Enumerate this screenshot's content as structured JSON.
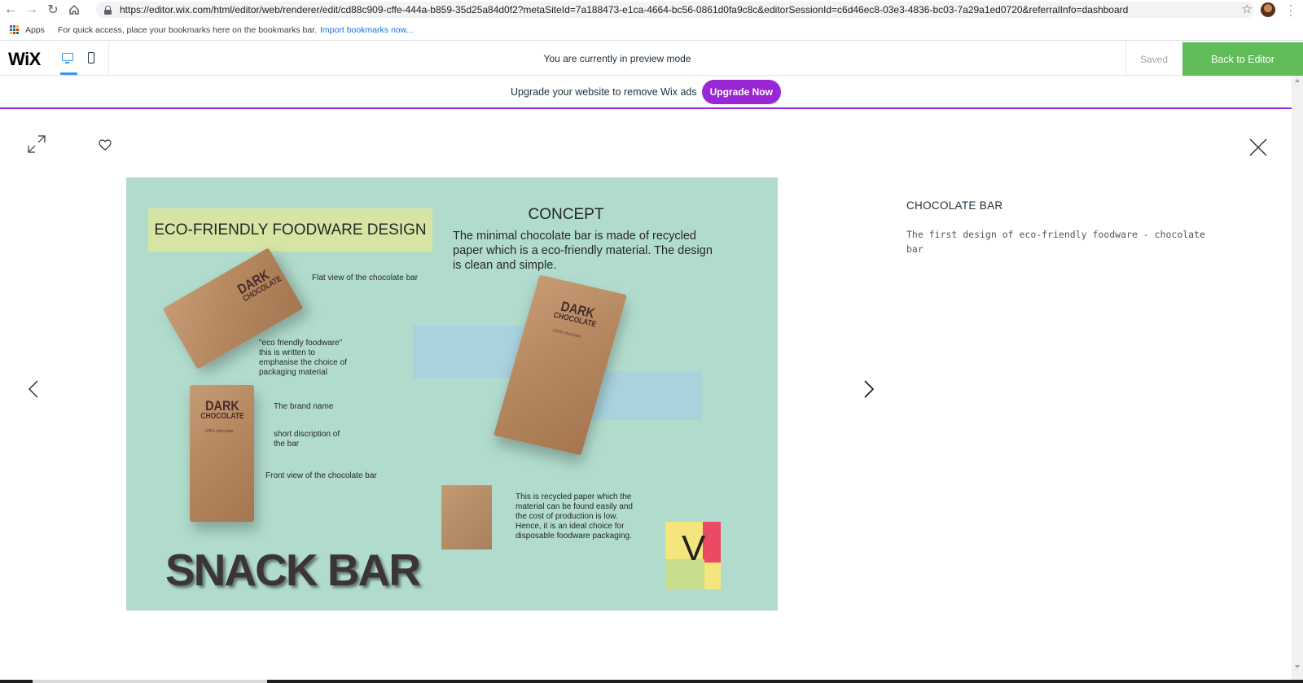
{
  "browser": {
    "url": "https://editor.wix.com/html/editor/web/renderer/edit/cd88c909-cffe-444a-b859-35d25a84d0f2?metaSiteId=7a188473-e1ca-4664-bc56-0861d0fa9c8c&editorSessionId=c6d46ec8-03e3-4836-bc03-7a29a1ed0720&referralInfo=dashboard",
    "apps_label": "Apps",
    "bookmarks_hint": "For quick access, place your bookmarks here on the bookmarks bar.",
    "bookmarks_link": "Import bookmarks now..."
  },
  "wix_bar": {
    "logo": "WiX",
    "preview_message": "You are currently in preview mode",
    "saved_label": "Saved",
    "back_label": "Back to Editor"
  },
  "upgrade": {
    "message": "Upgrade your website to remove Wix ads",
    "button_label": "Upgrade Now",
    "accent_color": "#9a27d5"
  },
  "colors": {
    "editor_blue": "#3899ec",
    "back_green": "#60bc57"
  },
  "icons": [
    "expand-icon",
    "heart-icon",
    "close-icon",
    "chevron-left-icon",
    "chevron-right-icon"
  ],
  "poster": {
    "headline": "ECO-FRIENDLY FOODWARE DESIGN",
    "concept_title": "CONCEPT",
    "concept_body": "The minimal chocolate bar is made of recycled paper which is a eco-friendly material. The design is clean and simple.",
    "label_flat_view": "Flat view of the chocolate bar",
    "label_eco": "\"eco friendly foodware\" this is written to emphasise the choice of packaging material",
    "label_brand": "The brand name",
    "label_short_desc": "short discription of the bar",
    "label_front_view": "Front view of the chocolate bar",
    "label_recycled": "This is recycled paper which the material can be found easily and the cost of production is low. Hence, it is an ideal choice for disposable foodware packaging.",
    "snack_title": "SNACK BAR",
    "pack_brand_line1": "DARK",
    "pack_brand_line2": "CHOCOLATE",
    "pack_percent": "100% chocolate",
    "logo_letter": "V"
  },
  "item": {
    "title": "CHOCOLATE BAR",
    "description": "The first design of eco-friendly foodware - chocolate bar"
  }
}
